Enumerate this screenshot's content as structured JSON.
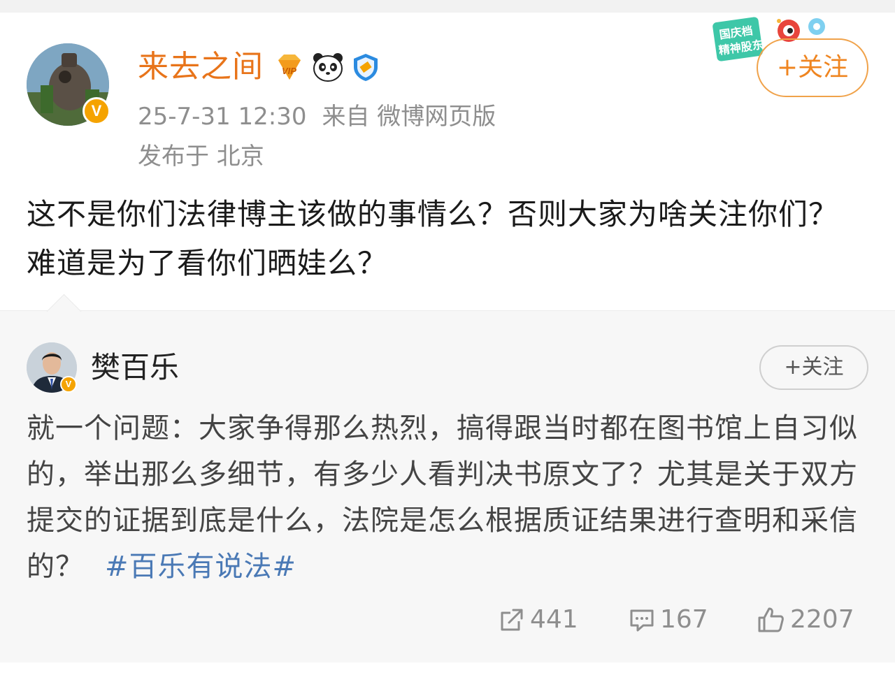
{
  "post": {
    "author": "来去之间",
    "timestamp": "25-7-31 12:30",
    "source": "来自 微博网页版",
    "location": "发布于 北京",
    "follow_label": "+关注",
    "text": "这不是你们法律博主该做的事情么？否则大家为啥关注你们？难道是为了看你们晒娃么？",
    "promo_text": "国庆档 精神股东",
    "badges": [
      "vip-diamond-icon",
      "panda-icon",
      "verified-shield-icon"
    ],
    "avatar_badge": "V"
  },
  "repost": {
    "author": "樊百乐",
    "avatar_badge": "V",
    "follow_label": "+关注",
    "text": "就一个问题：大家争得那么热烈，搞得跟当时都在图书馆上自习似的，举出那么多细节，有多少人看判决书原文了？尤其是关于双方提交的证据到底是什么，法院是怎么根据质证结果进行查明和采信的？",
    "hashtag": "#百乐有说法#",
    "reposts": "441",
    "comments": "167",
    "likes": "2207"
  },
  "colors": {
    "author_name": "#e8741a",
    "follow_border": "#f0a24a",
    "hashtag": "#4a79b5",
    "verified_badge": "#f5a300",
    "meta_text": "#8e8e8e"
  }
}
